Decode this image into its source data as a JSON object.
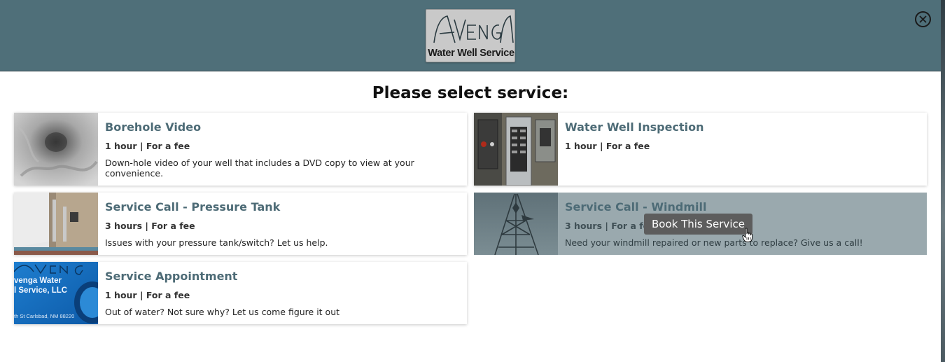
{
  "logo": {
    "brand": "AVENGA",
    "subtitle": "Water Well Service"
  },
  "close_icon": "close-icon",
  "title": "Please select service:",
  "services": [
    {
      "name": "Borehole Video",
      "meta": "1 hour | For a fee",
      "desc": "Down-hole video of your well that includes a DVD copy to view at your convenience."
    },
    {
      "name": "Water Well Inspection",
      "meta": "1 hour | For a fee",
      "desc": ""
    },
    {
      "name": "Service Call - Pressure Tank",
      "meta": "3 hours | For a fee",
      "desc": "Issues with your pressure tank/switch? Let us help."
    },
    {
      "name": "Service Call - Windmill",
      "meta": "3 hours | For a fee",
      "desc": "Need your windmill repaired or new parts to replace? Give us a call!"
    },
    {
      "name": "Service Appointment",
      "meta": "1 hour | For a fee",
      "desc": "Out of water? Not sure why? Let us come figure it out"
    }
  ],
  "thumb_texts": {
    "appointment": [
      "venga Water",
      "l Service, LLC",
      "th St Carlsbad, NM 88220"
    ]
  },
  "tooltip": "Book This Service",
  "colors": {
    "header": "#4f6f79",
    "accent": "#4d6b76",
    "hover": "#9aa9ae"
  }
}
